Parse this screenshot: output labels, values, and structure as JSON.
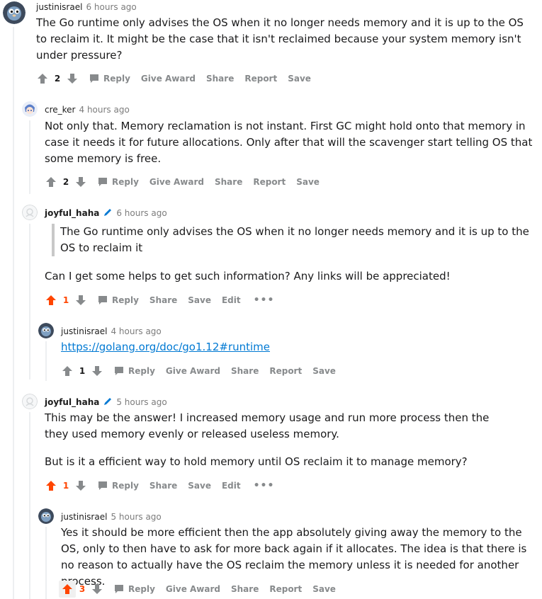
{
  "comments": [
    {
      "author": "justinisrael",
      "time": "6 hours ago",
      "body": [
        "The Go runtime only advises the OS when it no longer needs memory and it is up to the OS to reclaim it. It might be the case that it isn't reclaimed because your system memory isn't under pressure?"
      ],
      "score": "2",
      "actions": [
        "Reply",
        "Give Award",
        "Share",
        "Report",
        "Save"
      ]
    },
    {
      "author": "cre_ker",
      "time": "4 hours ago",
      "body": [
        "Not only that. Memory reclamation is not instant. First GC might hold onto that memory in case it needs it for future allocations. Only after that will the scavenger start telling OS that some memory is free."
      ],
      "score": "2",
      "actions": [
        "Reply",
        "Give Award",
        "Share",
        "Report",
        "Save"
      ]
    },
    {
      "author": "joyful_haha",
      "time": "6 hours ago",
      "quote": "The Go runtime only advises the OS when it no longer needs memory and it is up to the OS to reclaim it",
      "body": [
        "Can I get some helps to get such information? Any links will be appreciated!"
      ],
      "score": "1",
      "actions": [
        "Reply",
        "Share",
        "Save",
        "Edit"
      ],
      "more": "•••"
    },
    {
      "author": "justinisrael",
      "time": "4 hours ago",
      "link": "https://golang.org/doc/go1.12#runtime",
      "score": "1",
      "actions": [
        "Reply",
        "Give Award",
        "Share",
        "Report",
        "Save"
      ]
    },
    {
      "author": "joyful_haha",
      "time": "5 hours ago",
      "body": [
        "This may be the answer! I increased memory usage and run more process then the they used memory evenly or released useless memory.",
        "But is it a efficient way to hold memory until OS reclaim it to manage memory?"
      ],
      "score": "1",
      "actions": [
        "Reply",
        "Share",
        "Save",
        "Edit"
      ],
      "more": "•••"
    },
    {
      "author": "justinisrael",
      "time": "5 hours ago",
      "body": [
        "Yes it should be more efficient then the app absolutely giving away the memory to the OS, only to then have to ask for more back again if it allocates. The idea is that there is no reason to actually have the OS reclaim the memory unless it is needed for another process."
      ],
      "score": "3",
      "actions": [
        "Reply",
        "Give Award",
        "Share",
        "Report",
        "Save"
      ]
    }
  ],
  "colors": {
    "upvote_active": "#ff4500",
    "link": "#0079d3",
    "action_gray": "#878a8c",
    "thread_line": "#edeff1"
  },
  "icons": [
    "upvote-arrow-icon",
    "downvote-arrow-icon",
    "comment-bubble-icon",
    "pencil-icon",
    "more-dots-icon"
  ]
}
